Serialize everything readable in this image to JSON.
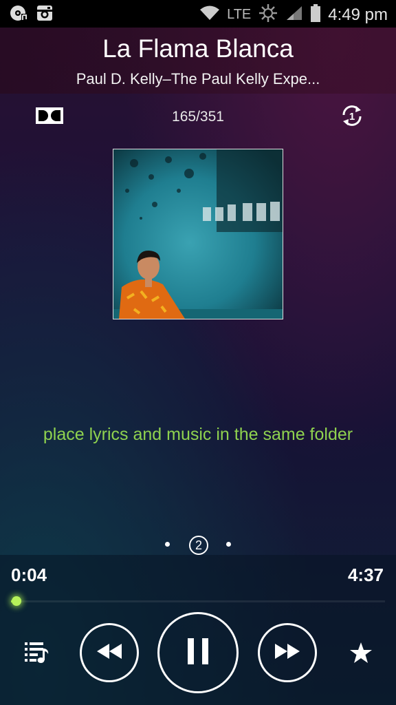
{
  "status_bar": {
    "network": "LTE",
    "time": "4:49 pm"
  },
  "header": {
    "title": "La Flama Blanca",
    "artist": "Paul D. Kelly–The Paul Kelly Expe..."
  },
  "track_counter": "165/351",
  "lyrics_hint": "place lyrics and music in the same folder",
  "pager": {
    "current_page": "2"
  },
  "player": {
    "elapsed": "0:04",
    "total": "4:37",
    "progress_fraction": 0.014
  },
  "icons": {
    "status_left": [
      "music-notification-icon",
      "instagram-icon"
    ],
    "status_right": [
      "wifi-icon",
      "nfc-icon",
      "signal-icon",
      "battery-icon"
    ],
    "top_left": "dolby-icon",
    "top_right": "repeat-one-icon",
    "controls": [
      "playlist-icon",
      "rewind-icon",
      "pause-icon",
      "fast-forward-icon",
      "star-icon"
    ]
  },
  "colors": {
    "accent": "#8fd24f",
    "progress": "#9be04c"
  }
}
